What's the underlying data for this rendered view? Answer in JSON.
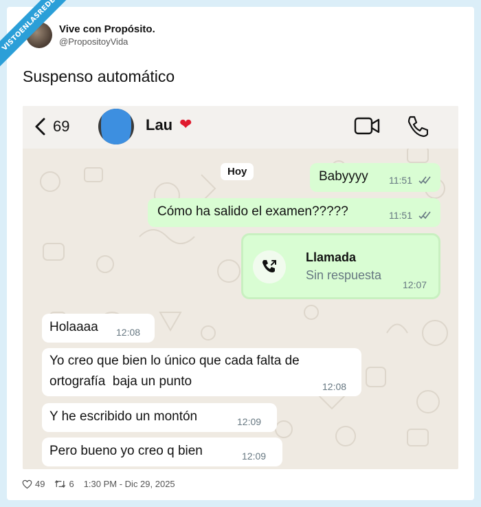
{
  "watermark": "VISTOENLASREDES",
  "tweet": {
    "display_name": "Vive con Propósito.",
    "handle": "@PropositoyVida",
    "text": "Suspenso automático"
  },
  "chat": {
    "back_count": "69",
    "contact_name": "Lau",
    "date_label": "Hoy",
    "messages": [
      {
        "direction": "out",
        "text": "Babyyyy",
        "time": "11:51"
      },
      {
        "direction": "out",
        "text": "Cómo ha salido el examen?????",
        "time": "11:51"
      },
      {
        "direction": "out",
        "type": "call",
        "title": "Llamada",
        "subtitle": "Sin respuesta",
        "time": "12:07"
      },
      {
        "direction": "in",
        "text": "Holaaaa",
        "time": "12:08"
      },
      {
        "direction": "in",
        "line1": "Yo creo que bien lo único que cada falta de",
        "line2": "ortografía  baja un punto",
        "time": "12:08"
      },
      {
        "direction": "in",
        "text": "Y he escribido un montón",
        "time": "12:09"
      },
      {
        "direction": "in",
        "text": "Pero bueno yo creo q bien",
        "time": "12:09"
      }
    ],
    "icons": [
      "back-chevron-icon",
      "video-call-icon",
      "phone-icon",
      "missed-call-icon",
      "double-check-icon"
    ],
    "colors": {
      "outgoing_bubble": "#d9fdd3",
      "incoming_bubble": "#ffffff",
      "chat_background": "#efeae2",
      "heart": "#e01b2e"
    }
  },
  "footer": {
    "likes": "49",
    "retweets": "6",
    "timestamp": "1:30 PM - Dic 29, 2025"
  }
}
